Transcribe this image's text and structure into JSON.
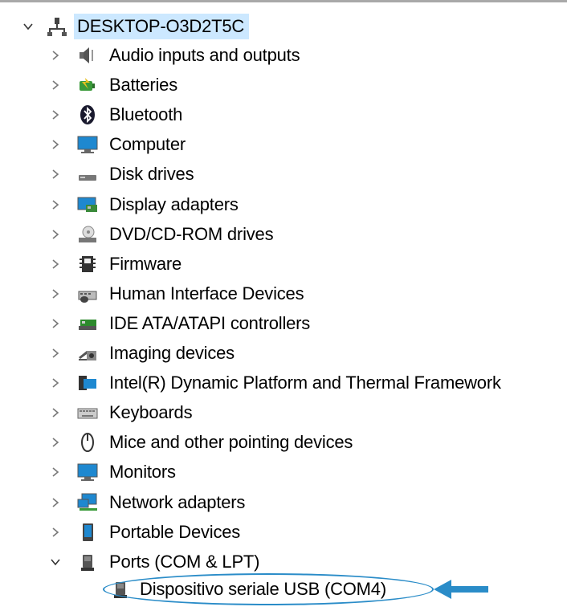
{
  "tree": {
    "root": {
      "label": "DESKTOP-O3D2T5C",
      "icon": "computer-network-icon",
      "expanded": true
    },
    "categories": [
      {
        "label": "Audio inputs and outputs",
        "icon": "speaker-icon"
      },
      {
        "label": "Batteries",
        "icon": "battery-icon"
      },
      {
        "label": "Bluetooth",
        "icon": "bluetooth-icon"
      },
      {
        "label": "Computer",
        "icon": "monitor-icon"
      },
      {
        "label": "Disk drives",
        "icon": "disk-drive-icon"
      },
      {
        "label": "Display adapters",
        "icon": "display-adapter-icon"
      },
      {
        "label": "DVD/CD-ROM drives",
        "icon": "dvd-drive-icon"
      },
      {
        "label": "Firmware",
        "icon": "chip-icon"
      },
      {
        "label": "Human Interface Devices",
        "icon": "hid-icon"
      },
      {
        "label": "IDE ATA/ATAPI controllers",
        "icon": "ide-controller-icon"
      },
      {
        "label": "Imaging devices",
        "icon": "camera-icon"
      },
      {
        "label": "Intel(R) Dynamic Platform and Thermal Framework",
        "icon": "folder-device-icon"
      },
      {
        "label": "Keyboards",
        "icon": "keyboard-icon"
      },
      {
        "label": "Mice and other pointing devices",
        "icon": "mouse-icon"
      },
      {
        "label": "Monitors",
        "icon": "monitor-icon"
      },
      {
        "label": "Network adapters",
        "icon": "network-adapter-icon"
      },
      {
        "label": "Portable Devices",
        "icon": "portable-device-icon"
      },
      {
        "label": "Ports (COM & LPT)",
        "icon": "port-icon",
        "expanded": true
      }
    ],
    "ports_children": [
      {
        "label": "Dispositivo seriale USB (COM4)",
        "icon": "port-icon",
        "highlighted": true
      }
    ]
  },
  "annotation": {
    "arrow_color": "#2a8cc8",
    "ellipse_color": "#2a8cc8"
  }
}
